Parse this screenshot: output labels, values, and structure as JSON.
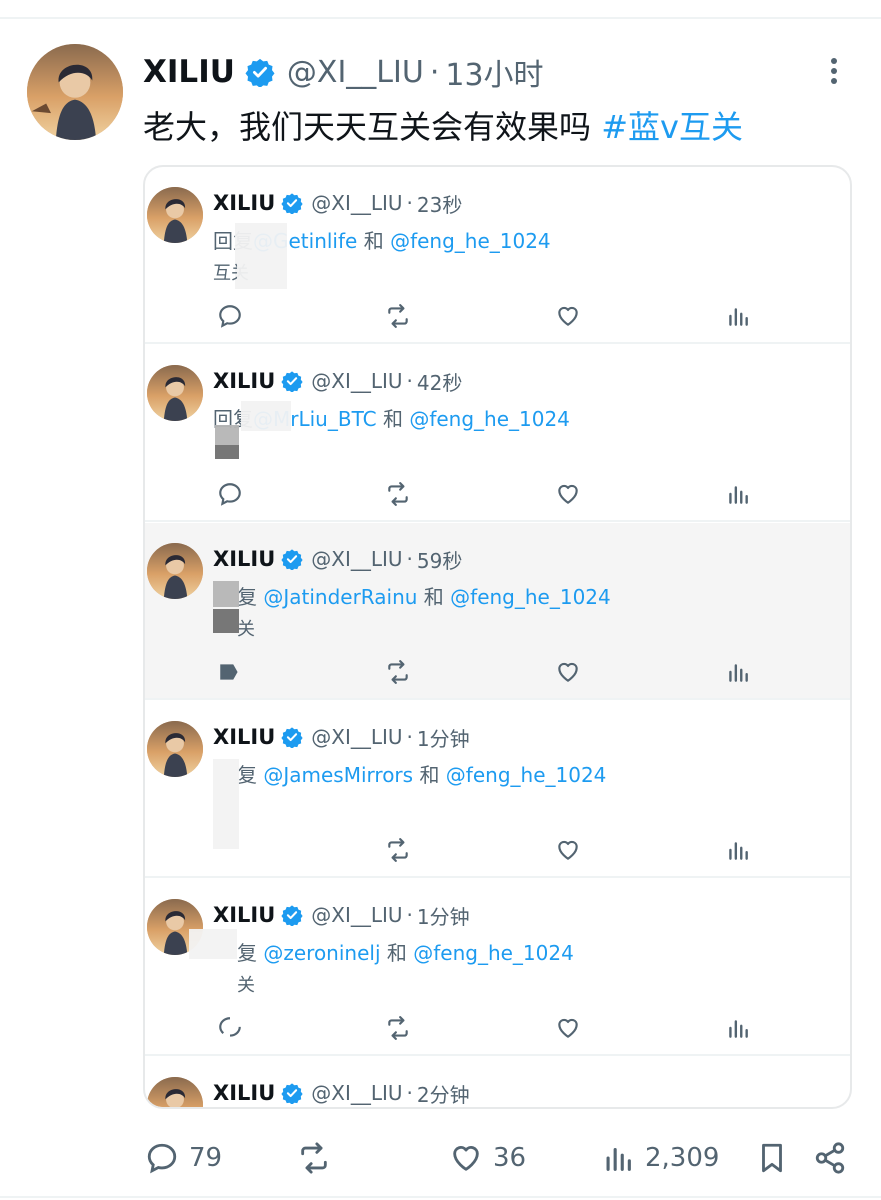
{
  "tweet": {
    "author_name": "XILIU",
    "author_handle": "@XI__LIU",
    "time": "13小时",
    "text": "老大，我们天天互关会有效果吗",
    "hashtag": "#蓝v互关",
    "more_icon": "more-dots-icon"
  },
  "replies": [
    {
      "name": "XILIU",
      "handle": "@XI__LIU",
      "time": "23秒",
      "reply_prefix": "回复",
      "mention1": "@Getinlife",
      "mention1_visible": "etinlife",
      "and": "和",
      "mention2": "@feng_he_1024",
      "body": "互关"
    },
    {
      "name": "XILIU",
      "handle": "@XI__LIU",
      "time": "42秒",
      "reply_prefix": "回复",
      "mention1": "@MrLiu_BTC",
      "mention1_visible": "rLiu_BTC",
      "and": "和",
      "mention2": "@feng_he_1024",
      "body": ""
    },
    {
      "name": "XILIU",
      "handle": "@XI__LIU",
      "time": "59秒",
      "reply_prefix": "复",
      "mention1": "@JatinderRainu",
      "mention1_visible": "@JatinderRainu",
      "and": "和",
      "mention2": "@feng_he_1024",
      "body": "关"
    },
    {
      "name": "XILIU",
      "handle": "@XI__LIU",
      "time": "1分钟",
      "reply_prefix": "复",
      "mention1": "@JamesMirrors",
      "mention1_visible": "@JamesMirrors",
      "and": "和",
      "mention2": "@feng_he_1024",
      "body": ""
    },
    {
      "name": "XILIU",
      "handle": "@XI__LIU",
      "time": "1分钟",
      "reply_prefix": "复",
      "mention1": "@zeroninelj",
      "mention1_visible": "@zeroninelj",
      "and": "和",
      "mention2": "@feng_he_1024",
      "body": "关"
    },
    {
      "name": "XILIU",
      "handle": "@XI__LIU",
      "time": "2分钟"
    }
  ],
  "stats": {
    "replies": "79",
    "likes": "36",
    "views": "2,309"
  },
  "colors": {
    "link": "#1d9bf0",
    "muted": "#536471",
    "text": "#0f1419",
    "border": "#e7e9ea"
  }
}
